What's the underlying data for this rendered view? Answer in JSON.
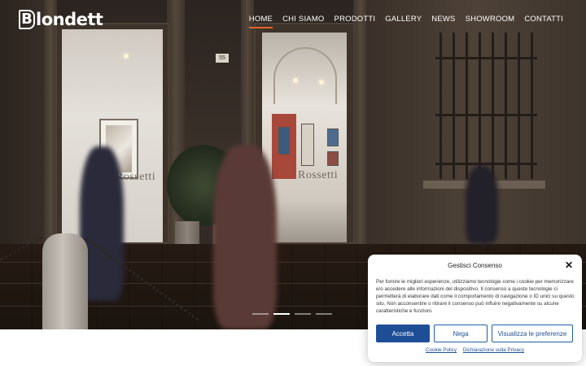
{
  "brand": {
    "logo_letter": "B",
    "logo_text": "londett"
  },
  "nav": {
    "items": [
      {
        "label": "HOME",
        "active": true
      },
      {
        "label": "CHI SIAMO",
        "active": false
      },
      {
        "label": "PRODOTTI",
        "active": false
      },
      {
        "label": "GALLERY",
        "active": false
      },
      {
        "label": "NEWS",
        "active": false
      },
      {
        "label": "SHOWROOM",
        "active": false
      },
      {
        "label": "CONTATTI",
        "active": false
      }
    ],
    "active_color": "#e9622b"
  },
  "hero": {
    "house_number": "55",
    "sign_text_left": "Rossetti",
    "sign_text_right": "Rossetti",
    "slides_total": 4,
    "slide_active": 2
  },
  "cookie": {
    "title": "Gestisci Consenso",
    "body": "Per fornire le migliori esperienze, utilizziamo tecnologie come i cookie per memorizzare e/o accedere alle informazioni del dispositivo. Il consenso a queste tecnologie ci permetterà di elaborare dati come il comportamento di navigazione o ID unici su questo sito. Non acconsentire o ritirare il consenso può influire negativamente su alcune caratteristiche e funzioni.",
    "accept_label": "Accetta",
    "deny_label": "Nega",
    "preferences_label": "Visualizza le preferenze",
    "cookie_policy_label": "Cookie Policy",
    "privacy_label": "Dichiarazione sulla Privacy",
    "accent_color": "#1e4f96"
  }
}
